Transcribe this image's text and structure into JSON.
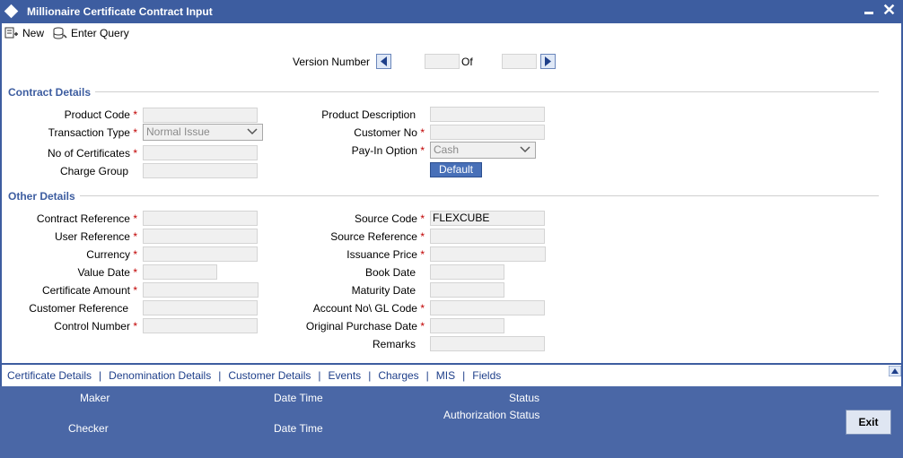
{
  "window": {
    "title": "Millionaire Certificate Contract Input"
  },
  "toolbar": {
    "new_label": "New",
    "enter_query_label": "Enter Query"
  },
  "version": {
    "label": "Version Number",
    "of_label": "Of",
    "current": "",
    "total": ""
  },
  "contract_details": {
    "title": "Contract Details",
    "product_code": {
      "label": "Product Code",
      "value": ""
    },
    "transaction_type": {
      "label": "Transaction Type",
      "value": "Normal Issue"
    },
    "no_of_certificates": {
      "label": "No of Certificates",
      "value": ""
    },
    "charge_group": {
      "label": "Charge Group",
      "value": ""
    },
    "product_description": {
      "label": "Product Description",
      "value": ""
    },
    "customer_no": {
      "label": "Customer No",
      "value": ""
    },
    "pay_in_option": {
      "label": "Pay-In Option",
      "value": "Cash"
    },
    "default_button": "Default"
  },
  "other_details": {
    "title": "Other Details",
    "contract_reference": {
      "label": "Contract Reference",
      "value": ""
    },
    "user_reference": {
      "label": "User Reference",
      "value": ""
    },
    "currency": {
      "label": "Currency",
      "value": ""
    },
    "value_date": {
      "label": "Value Date",
      "value": ""
    },
    "certificate_amount": {
      "label": "Certificate Amount",
      "value": ""
    },
    "customer_reference": {
      "label": "Customer Reference",
      "value": ""
    },
    "control_number": {
      "label": "Control Number",
      "value": ""
    },
    "source_code": {
      "label": "Source Code",
      "value": "FLEXCUBE"
    },
    "source_reference": {
      "label": "Source Reference",
      "value": ""
    },
    "issuance_price": {
      "label": "Issuance Price",
      "value": ""
    },
    "book_date": {
      "label": "Book Date",
      "value": ""
    },
    "maturity_date": {
      "label": "Maturity Date",
      "value": ""
    },
    "account_gl_code": {
      "label": "Account No\\ GL Code",
      "value": ""
    },
    "original_purchase_date": {
      "label": "Original Purchase Date",
      "value": ""
    },
    "remarks": {
      "label": "Remarks",
      "value": ""
    }
  },
  "tabs": [
    "Certificate Details",
    "Denomination Details",
    "Customer Details",
    "Events",
    "Charges",
    "MIS",
    "Fields"
  ],
  "tab_separator": "|",
  "required_marker": "*",
  "footer": {
    "maker": "Maker",
    "checker": "Checker",
    "date_time_1": "Date Time",
    "date_time_2": "Date Time",
    "status": "Status",
    "authorization_status": "Authorization Status",
    "exit_label": "Exit"
  },
  "colors": {
    "title_bar": "#3d5da0",
    "footer": "#4a67a6",
    "section_title": "#3d5da0",
    "required": "#c00000",
    "tab_link": "#1e3f8a"
  },
  "icons": {
    "window": "diamond-icon",
    "minimize": "minimize-icon",
    "close": "close-icon",
    "new": "new-document-icon",
    "enter_query": "query-icon",
    "prev": "chevron-left-icon",
    "next": "chevron-right-icon",
    "dropdown": "chevron-down-icon",
    "scroll_up": "triangle-up-icon"
  }
}
